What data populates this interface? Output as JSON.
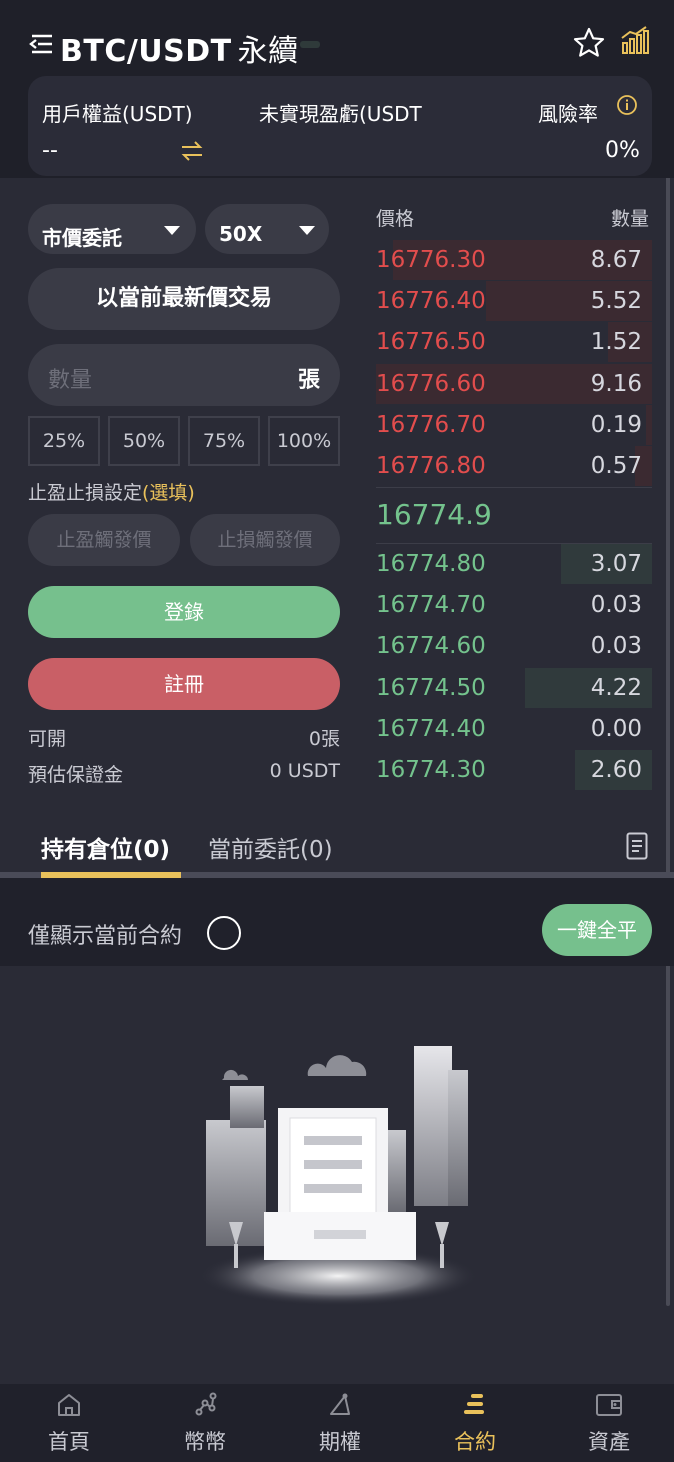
{
  "header": {
    "pair": "BTC/USDT",
    "contract_type": "永續"
  },
  "account": {
    "equity_label": "用戶權益(USDT)",
    "equity_value": "--",
    "unrealized_label": "未實現盈虧(USDT",
    "risk_label": "風險率",
    "risk_value": "0%"
  },
  "order_form": {
    "order_type": "市價委託",
    "leverage": "50X",
    "market_trade_label": "以當前最新價交易",
    "quantity_placeholder": "數量",
    "quantity_unit": "張",
    "percent_options": [
      "25%",
      "50%",
      "75%",
      "100%"
    ],
    "tpsl_title": "止盈止損設定",
    "tpsl_optional": "(選填)",
    "take_profit_placeholder": "止盈觸發價",
    "stop_loss_placeholder": "止損觸發價",
    "login_label": "登錄",
    "register_label": "註冊",
    "available_label": "可開",
    "available_value": "0張",
    "margin_label": "預估保證金",
    "margin_value": "0 USDT"
  },
  "order_book": {
    "price_header": "價格",
    "qty_header": "數量",
    "asks": [
      {
        "price": "16776.30",
        "qty": "8.67",
        "depth": 0.94
      },
      {
        "price": "16776.40",
        "qty": "5.52",
        "depth": 0.6
      },
      {
        "price": "16776.50",
        "qty": "1.52",
        "depth": 0.16
      },
      {
        "price": "16776.60",
        "qty": "9.16",
        "depth": 1.0
      },
      {
        "price": "16776.70",
        "qty": "0.19",
        "depth": 0.02
      },
      {
        "price": "16776.80",
        "qty": "0.57",
        "depth": 0.06
      }
    ],
    "last_price": "16774.9",
    "bids": [
      {
        "price": "16774.80",
        "qty": "3.07",
        "depth": 0.33
      },
      {
        "price": "16774.70",
        "qty": "0.03",
        "depth": 0.0
      },
      {
        "price": "16774.60",
        "qty": "0.03",
        "depth": 0.0
      },
      {
        "price": "16774.50",
        "qty": "4.22",
        "depth": 0.46
      },
      {
        "price": "16774.40",
        "qty": "0.00",
        "depth": 0.0
      },
      {
        "price": "16774.30",
        "qty": "2.60",
        "depth": 0.28
      }
    ]
  },
  "positions": {
    "tab_positions": "持有倉位(0)",
    "tab_orders": "當前委託(0)",
    "current_only_label": "僅顯示當前合約",
    "close_all_label": "一鍵全平"
  },
  "nav": {
    "items": [
      {
        "label": "首頁",
        "icon": "home-icon"
      },
      {
        "label": "幣幣",
        "icon": "spot-icon"
      },
      {
        "label": "期權",
        "icon": "options-icon"
      },
      {
        "label": "合約",
        "icon": "contract-icon",
        "active": true
      },
      {
        "label": "資產",
        "icon": "wallet-icon"
      }
    ]
  },
  "colors": {
    "accent": "#e9c15b",
    "up": "#74c38d",
    "down": "#e24d4d",
    "login": "#76c08d",
    "register": "#c95f66"
  }
}
